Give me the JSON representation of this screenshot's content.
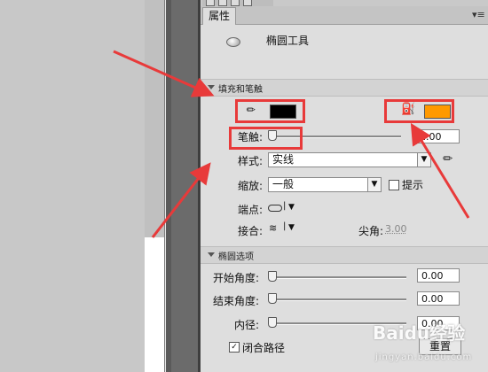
{
  "panel": {
    "tab_label": "属性",
    "menu_glyph": "▾≡",
    "tool_name": "椭圆工具"
  },
  "fill_stroke": {
    "section_title": "填充和笔触",
    "stroke_color": "#000000",
    "fill_color": "#ff9900",
    "stroke_label": "笔触:",
    "stroke_value": "1.00",
    "style_label": "样式:",
    "style_value": "实线",
    "scale_label": "缩放:",
    "scale_value": "一般",
    "hint_label": "提示",
    "cap_label": "端点:",
    "join_label": "接合:",
    "miter_label": "尖角:",
    "miter_value": "3.00"
  },
  "ellipse_options": {
    "section_title": "椭圆选项",
    "start_angle_label": "开始角度:",
    "start_angle_value": "0.00",
    "end_angle_label": "结束角度:",
    "end_angle_value": "0.00",
    "inner_radius_label": "内径:",
    "inner_radius_value": "0.00",
    "close_path_label": "闭合路径",
    "close_path_checked": true,
    "reset_label": "重置"
  },
  "watermark": {
    "text": "Baidu经验",
    "sub": "jingyan.baidu.com"
  },
  "colors": {
    "annotation_red": "#e83a3a",
    "panel_bg": "#dedede"
  }
}
